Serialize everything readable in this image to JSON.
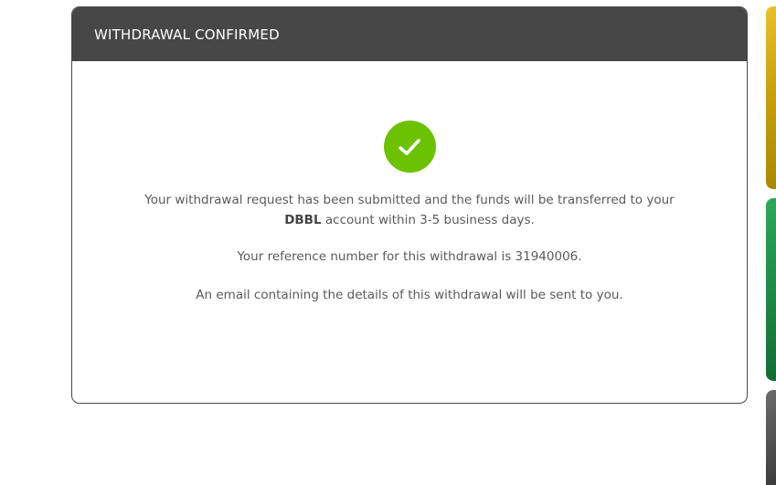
{
  "modal": {
    "title": "WITHDRAWAL CONFIRMED",
    "message_part1": "Your withdrawal request has been submitted and the funds will be transferred to your",
    "bank_name": "DBBL",
    "message_part2": " account within 3-5 business days.",
    "reference_text": "Your reference number for this withdrawal is 31940006.",
    "email_text": "An email containing the details of this withdrawal will be sent to you."
  },
  "icons": {
    "success": "check-circle-icon"
  },
  "colors": {
    "header_bg": "#474747",
    "success_green": "#6cc200",
    "text": "#5a5a5a"
  }
}
